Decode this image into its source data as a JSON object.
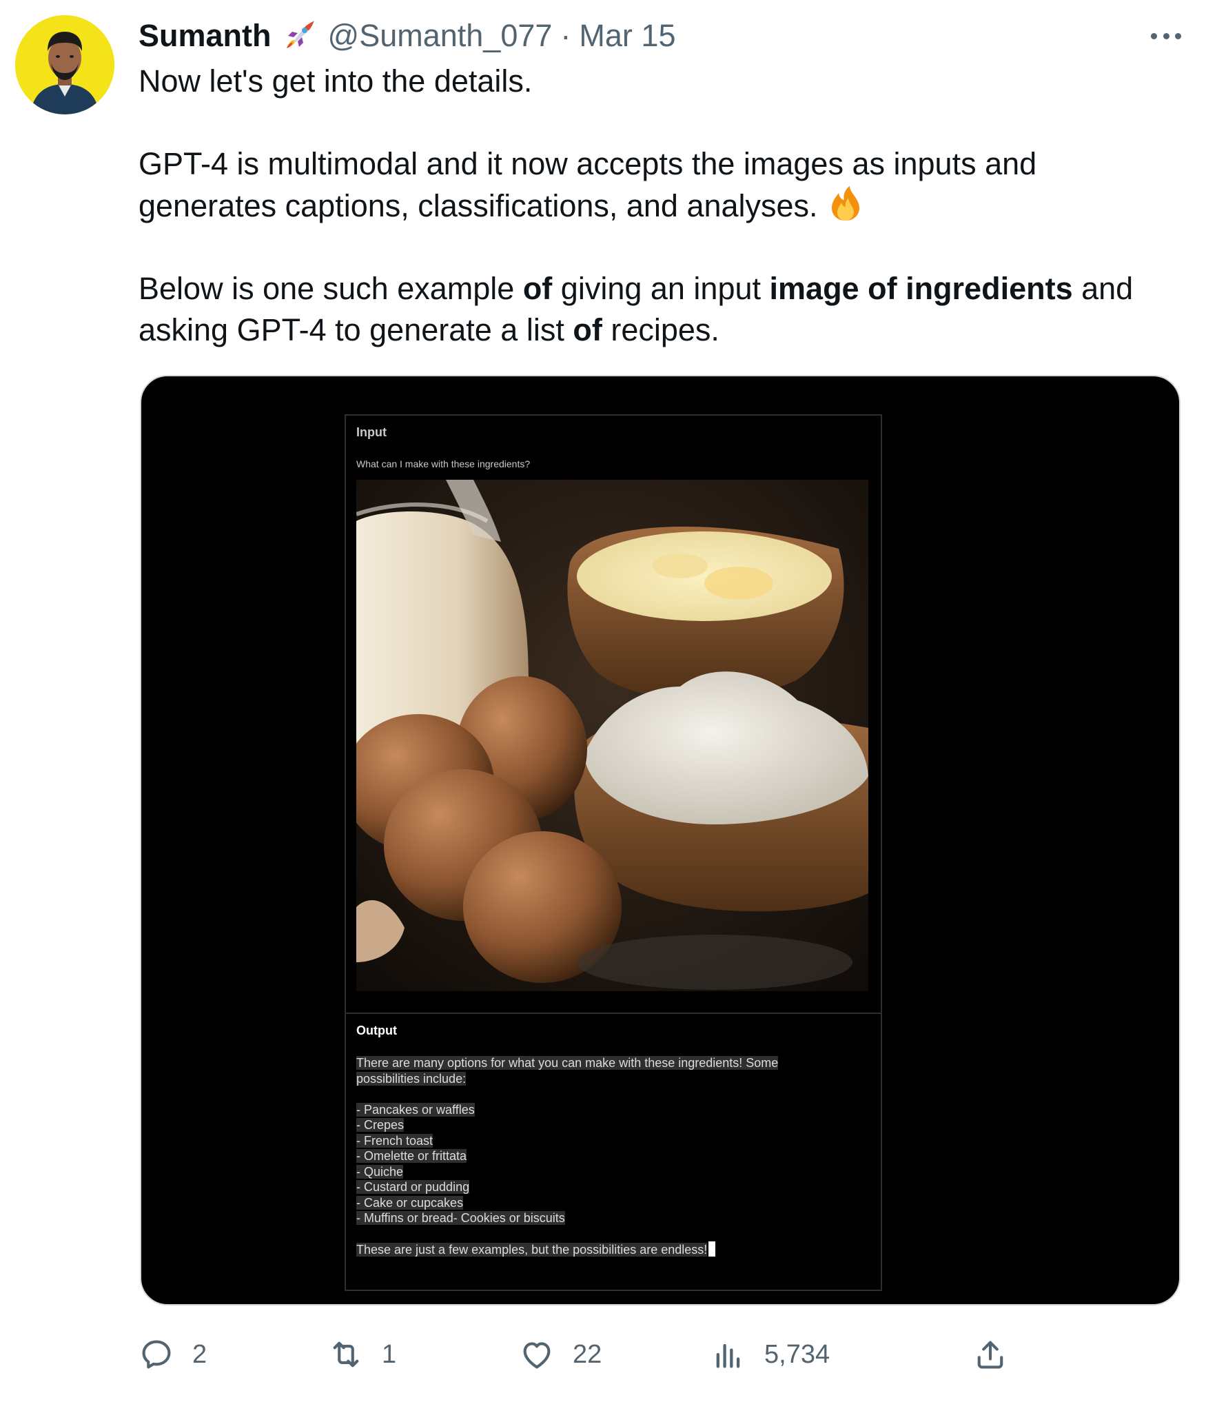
{
  "tweet": {
    "author_name": "Sumanth",
    "author_badge_icon": "rocket-emoji",
    "handle": "@Sumanth_077",
    "separator": "·",
    "date": "Mar 15",
    "paragraph1": "Now let's get into the details.",
    "paragraph2": "GPT-4 is multimodal and it now accepts the images as inputs and generates captions, classifications, and analyses.",
    "paragraph2_emoji_icon": "fire-emoji",
    "paragraph3": {
      "t1": "Below is one such example ",
      "b1": "of",
      "t2": " giving an input ",
      "b2": "image of ingredients",
      "t3": " and asking GPT-4 to generate a list ",
      "b3": "of",
      "t4": " recipes."
    }
  },
  "media": {
    "input_label": "Input",
    "input_question": "What can I make with these ingredients?",
    "output_label": "Output",
    "output_intro_line1": "There are many options for what you can make with these ingredients! Some",
    "output_intro_line2": "possibilities include:",
    "output_items": [
      "- Pancakes or waffles",
      "- Crepes",
      "- French toast",
      "- Omelette or frittata",
      "- Quiche",
      "- Custard or pudding",
      "- Cake or cupcakes",
      "- Muffins or bread- Cookies or biscuits"
    ],
    "output_closing": "These are just a few examples, but the possibilities are endless!"
  },
  "actions": {
    "reply_count": "2",
    "retweet_count": "1",
    "like_count": "22",
    "views_count": "5,734"
  },
  "colors": {
    "text_primary": "#0f1419",
    "text_secondary": "#536471",
    "media_border": "#cfd9de",
    "avatar_bg": "#f4e318"
  }
}
